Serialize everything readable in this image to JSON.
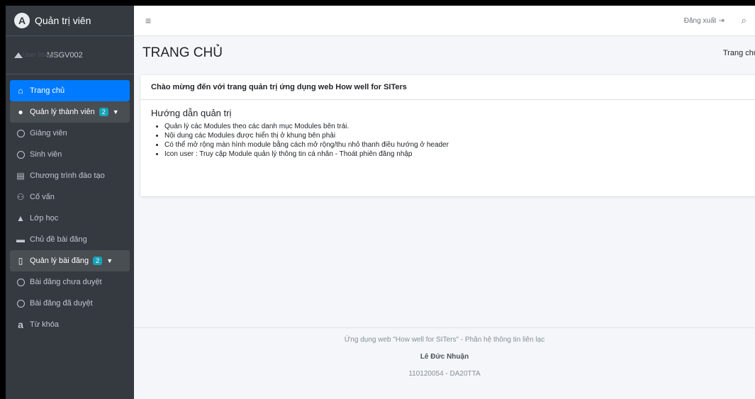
{
  "brand": {
    "title": "Quản trị viên",
    "logo_letter": "A"
  },
  "user": {
    "image_alt": "User Image",
    "name": "MSGV002"
  },
  "sidebar": {
    "items": [
      {
        "label": "Trang chủ",
        "icon": "home-icon",
        "glyph": "⌂"
      },
      {
        "label": "Quản lý thành viên",
        "icon": "user-icon",
        "glyph": "●",
        "badge": "2"
      },
      {
        "label": "Giảng viên",
        "icon": "circle-icon"
      },
      {
        "label": "Sinh viên",
        "icon": "circle-icon"
      },
      {
        "label": "Chương trình đào tạo",
        "icon": "book-icon",
        "glyph": "▤"
      },
      {
        "label": "Cố vấn",
        "icon": "users-icon",
        "glyph": "⚇"
      },
      {
        "label": "Lớp học",
        "icon": "school-icon",
        "glyph": "▲"
      },
      {
        "label": "Chủ đề bài đăng",
        "icon": "folder-icon",
        "glyph": "▬"
      },
      {
        "label": "Quản lý bài đăng",
        "icon": "file-icon",
        "glyph": "▯",
        "badge": "2"
      },
      {
        "label": "Bài đăng chưa duyệt",
        "icon": "circle-icon"
      },
      {
        "label": "Bài đăng đã duyệt",
        "icon": "circle-icon"
      },
      {
        "label": "Từ khóa",
        "icon": "keyword-icon",
        "glyph": "a"
      }
    ]
  },
  "topbar": {
    "hamburger": "≡",
    "logout_label": "Đăng xuất",
    "logout_glyph": "⇥",
    "search_glyph": "⌕"
  },
  "header": {
    "title": "TRANG CHỦ",
    "breadcrumb": "Trang chủ"
  },
  "card": {
    "title": "Chào mừng đến với trang quản trị ứng dụng web How well for SITers",
    "heading": "Hướng dẫn quản trị",
    "bullets": [
      "Quản lý các Modules theo các danh mục Modules bên trái.",
      "Nội dung các Modules được hiển thị ở khung bên phải",
      "Có thể mở rộng màn hình module bằng cách mở rộng/thu nhỏ thanh điều hướng ở header",
      "Icon user : Truy cập Module quản lý thông tin cá nhân - Thoát phiên đăng nhập"
    ]
  },
  "footer": {
    "line1": "Ứng dụng web \"How well for SITers\" - Phân hệ thông tin liên lạc",
    "author": "Lê Đức Nhuận",
    "code": "110120054 - DA20TTA"
  },
  "colors": {
    "sidebar_bg": "#343a40",
    "active": "#007bff",
    "badge": "#17a2b8"
  }
}
